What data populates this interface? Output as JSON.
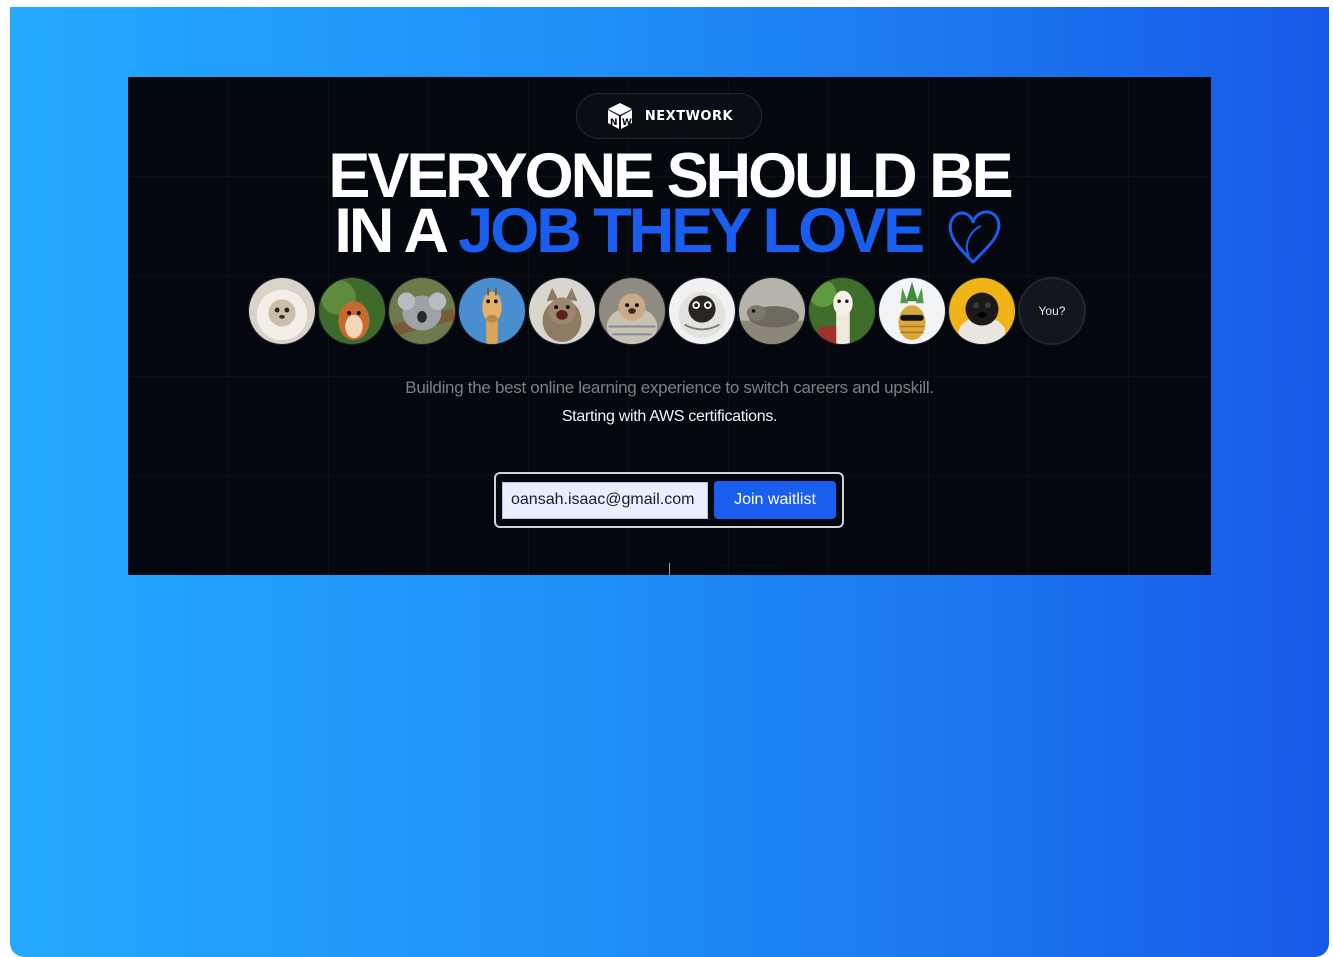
{
  "brand": {
    "name": "NEXTWORK",
    "icon": "nextwork-cube-logo"
  },
  "headline": {
    "line1": "EVERYONE SHOULD BE",
    "line2_prefix": "IN A",
    "line2_accent": "JOB THEY LOVE",
    "heart_icon": "heart-outline-icon"
  },
  "avatars": [
    {
      "name": "lion-dog-avatar"
    },
    {
      "name": "squirrel-avatar"
    },
    {
      "name": "koala-avatar"
    },
    {
      "name": "giraffe-avatar"
    },
    {
      "name": "cat-avatar"
    },
    {
      "name": "pug-blanket-avatar"
    },
    {
      "name": "pug-hoodie-avatar"
    },
    {
      "name": "seal-avatar"
    },
    {
      "name": "alpaca-avatar"
    },
    {
      "name": "pineapple-avatar"
    },
    {
      "name": "pug-yellow-avatar"
    }
  ],
  "you_label": "You?",
  "subtitle": {
    "line1": "Building the best online learning experience to switch careers and upskill.",
    "line2": "Starting with AWS certifications."
  },
  "form": {
    "email_value": "oansah.isaac@gmail.com",
    "button_label": "Join waitlist"
  },
  "colors": {
    "accent": "#1a5ef0",
    "background_dark": "#05070f",
    "frame_gradient_start": "#24a9ff",
    "frame_gradient_end": "#1759e8"
  }
}
